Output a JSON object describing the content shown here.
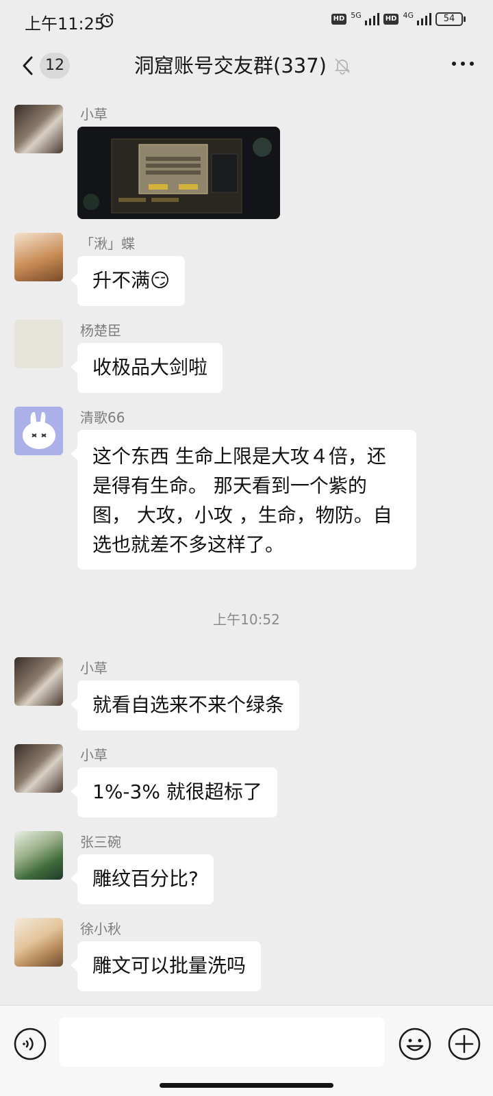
{
  "status_bar": {
    "time": "上午11:25",
    "network1": "5G",
    "network2": "4G",
    "hd": "HD",
    "battery": "54"
  },
  "header": {
    "unread_count": "12",
    "title": "洞窟账号交友群(337)"
  },
  "messages": [
    {
      "sender": "小草",
      "type": "image"
    },
    {
      "sender": "「湫」蝶",
      "text": "升不满😏"
    },
    {
      "sender": "杨楚臣",
      "text": "收极品大剑啦"
    },
    {
      "sender": "清歌66",
      "text": "这个东西 生命上限是大攻４倍，还是得有生命。 那天看到一个紫的图，  大攻，小攻 ，生命，物防。自选也就差不多这样了。"
    },
    {
      "sender": "小草",
      "text": "就看自选来不来个绿条"
    },
    {
      "sender": "小草",
      "text": "1%-3% 就很超标了"
    },
    {
      "sender": "张三碗",
      "text": "雕纹百分比?"
    },
    {
      "sender": "徐小秋",
      "text": "雕文可以批量洗吗"
    }
  ],
  "time_divider": "上午10:52",
  "colors": {
    "background": "#ededed",
    "bubble": "#ffffff",
    "input_bar": "#f7f7f7"
  }
}
